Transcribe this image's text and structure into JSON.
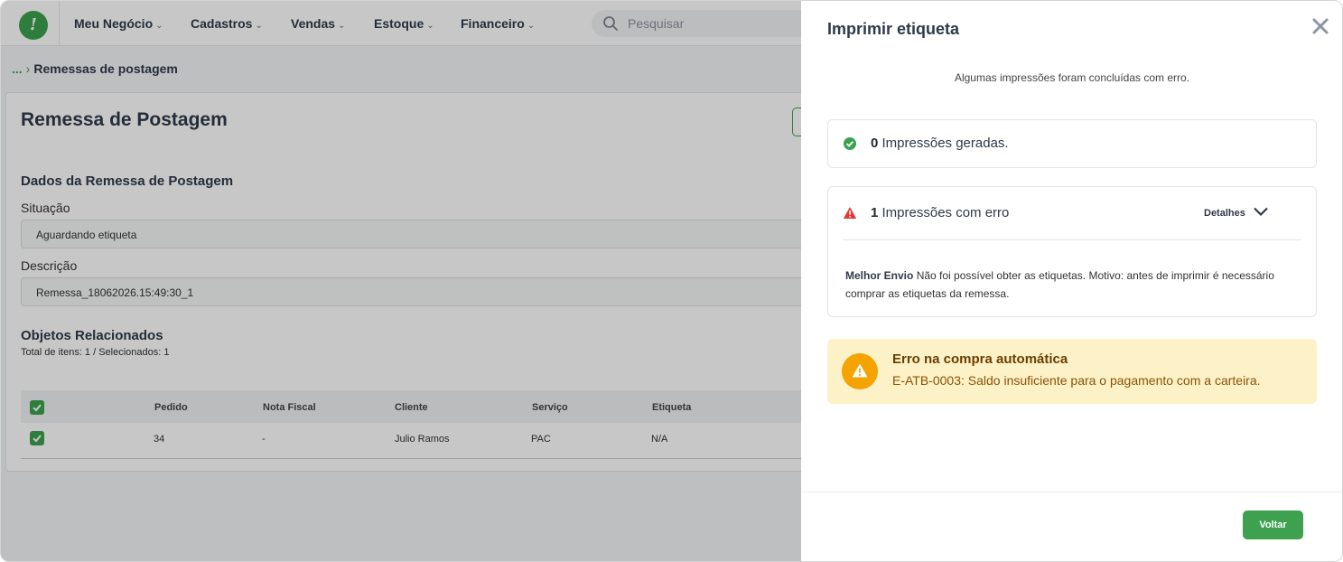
{
  "header": {
    "logo": "!",
    "nav": [
      {
        "label": "Meu Negócio"
      },
      {
        "label": "Cadastros"
      },
      {
        "label": "Vendas"
      },
      {
        "label": "Estoque"
      },
      {
        "label": "Financeiro"
      }
    ],
    "search_placeholder": "Pesquisar"
  },
  "breadcrumb": {
    "ellipsis": "...",
    "current": "Remessas de postagem"
  },
  "page": {
    "title": "Remessa de Postagem",
    "section_data": "Dados da Remessa de Postagem",
    "situacao_label": "Situação",
    "situacao_value": "Aguardando etiqueta",
    "descricao_label": "Descrição",
    "descricao_value": "Remessa_18062026.15:49:30_1",
    "section_objects": "Objetos Relacionados",
    "totals": "Total de itens: 1 / Selecionados: 1"
  },
  "table": {
    "columns": [
      "Pedido",
      "Nota Fiscal",
      "Cliente",
      "Serviço",
      "Etiqueta"
    ],
    "rows": [
      [
        "34",
        "-",
        "Julio Ramos",
        "PAC",
        "N/A"
      ]
    ]
  },
  "drawer": {
    "title": "Imprimir etiqueta",
    "message": "Algumas impressões foram concluídas com erro.",
    "success_count": "0",
    "success_text": "Impressões geradas.",
    "error_count": "1",
    "error_text": "Impressões com erro",
    "details_label": "Detalhes",
    "error_source": "Melhor Envio",
    "error_detail": "Não foi possível obter as etiquetas. Motivo: antes de imprimir é necessário comprar as etiquetas da remessa.",
    "alert_title": "Erro na compra automática",
    "alert_desc": "E-ATB-0003: Saldo insuficiente para o pagamento com a carteira.",
    "back_button": "Voltar"
  },
  "colors": {
    "brand_green": "#3da14f",
    "warning_orange": "#f4a300",
    "error_red": "#e53935",
    "alert_bg": "#fdf1c8"
  }
}
